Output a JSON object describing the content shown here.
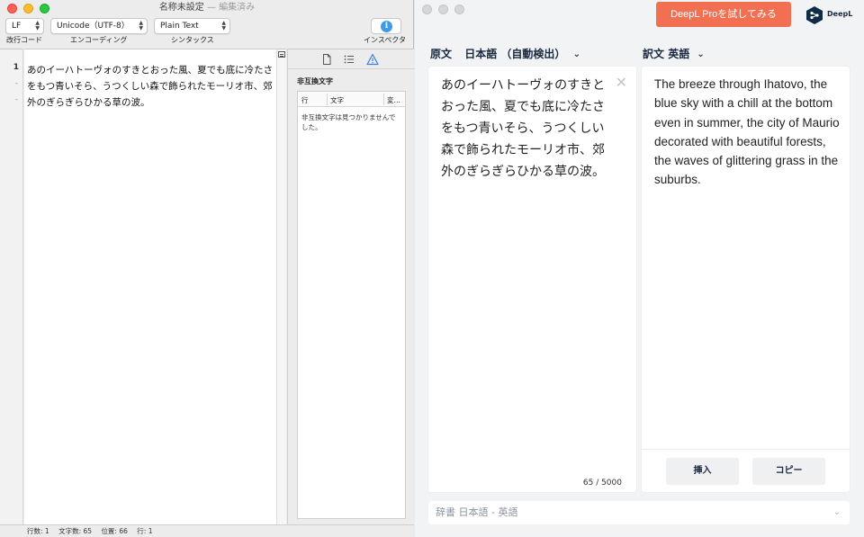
{
  "editor": {
    "title": "名称未設定",
    "title_status": "— 編集済み",
    "toolbar": {
      "line_ending": "LF",
      "encoding": "Unicode（UTF-8）",
      "syntax": "Plain Text",
      "label_line_ending": "改行コード",
      "label_encoding": "エンコーディング",
      "label_syntax": "シンタックス",
      "label_inspector": "インスペクタ",
      "info_icon": "i"
    },
    "gutter": {
      "line_number": "1"
    },
    "text": "あのイーハトーヴォのすきとおった風、夏でも底に冷たさをもつ青いそら、うつくしい森で飾られたモーリオ市、郊外のぎらぎらひかる草の波。",
    "inspector": {
      "title": "非互換文字",
      "col_line": "行",
      "col_char": "文字",
      "col_convert": "変…",
      "empty": "非互換文字は見つかりませんでした。"
    },
    "status": {
      "lines": "行数: 1",
      "chars": "文字数: 65",
      "position": "位置: 66",
      "line": "行: 1"
    }
  },
  "deepl": {
    "pro_button": "DeepL Proを試してみる",
    "logo_text": "DeepL",
    "source": {
      "label": "原文",
      "language": "日本語 （自動検出）",
      "text": "あのイーハトーヴォのすきとおった風、夏でも底に冷たさをもつ青いそら、うつくしい森で飾られたモーリオ市、郊外のぎらぎらひかる草の波。",
      "counter": "65 / 5000"
    },
    "target": {
      "label": "訳文",
      "language": "英語",
      "text": "The breeze through Ihatovo, the blue sky with a chill at the bottom even in summer, the city of Maurio decorated with beautiful forests, the waves of glittering grass in the suburbs.",
      "insert_button": "挿入",
      "copy_button": "コピー"
    },
    "dictionary": "辞書 日本語 - 英語",
    "colors": {
      "accent": "#f36f52",
      "navy": "#1b2940"
    }
  }
}
